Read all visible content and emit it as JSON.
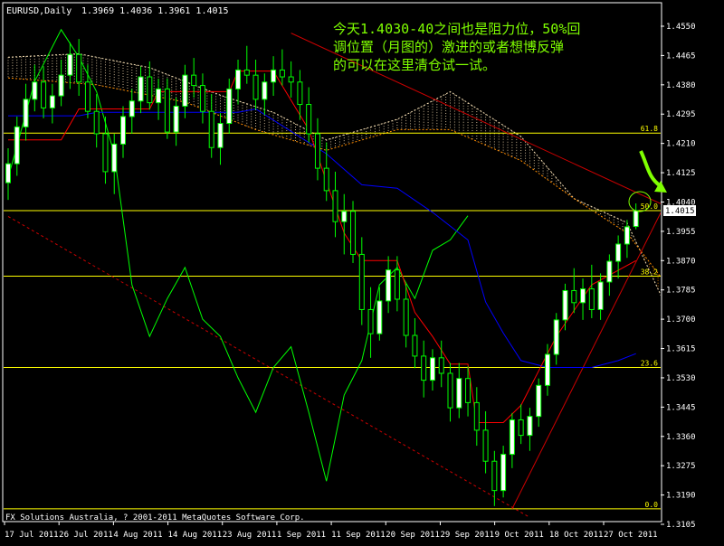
{
  "header": {
    "symbol": "EURUSD,Daily",
    "ohlc": "1.3969 1.4036 1.3961 1.4015"
  },
  "annotation": {
    "lines": [
      "今天1.4030-40之间也是阻力位，50%回",
      "调位置（月图的）激进的或者想博反弹",
      "的可以在这里清仓试一试。"
    ]
  },
  "footer": "FX Solutions Australia, ? 2001-2011 MetaQuotes Software Corp.",
  "colors": {
    "background": "#000000",
    "axis": "#ffffff",
    "candle_up": "#ffffff",
    "candle_down": "#000000",
    "candle_wick": "#00ff00",
    "kijun": "#ff0000",
    "tenkan": "#0000ff",
    "chikou": "#00ff00",
    "senkou_a": "#f5deb3",
    "senkou_b": "#ff8c00",
    "fib": "#ffff00",
    "trend": "#cc0000",
    "annotation": "#7fff00",
    "price_box_bg": "#ffffff",
    "price_box_fg": "#000000"
  },
  "chart_data": {
    "type": "candlestick",
    "title": "EURUSD,Daily",
    "ylim": [
      1.3105,
      1.455
    ],
    "y_ticks": [
      "1.4550",
      "1.4465",
      "1.4380",
      "1.4295",
      "1.4210",
      "1.4125",
      "1.4040",
      "1.3955",
      "1.3870",
      "1.3785",
      "1.3700",
      "1.3615",
      "1.3530",
      "1.3445",
      "1.3360",
      "1.3275",
      "1.3190",
      "1.3105"
    ],
    "x_ticks": [
      "17 Jul 2011",
      "26 Jul 2011",
      "4 Aug 2011",
      "14 Aug 2011",
      "23 Aug 2011",
      "1 Sep 2011",
      "11 Sep 2011",
      "20 Sep 2011",
      "29 Sep 2011",
      "9 Oct 2011",
      "18 Oct 2011",
      "27 Oct 2011"
    ],
    "current_price": "1.4015",
    "current_price_value": 1.4015,
    "fib_levels": [
      {
        "label": "61.8",
        "value": 1.424
      },
      {
        "label": "50.0",
        "value": 1.4015
      },
      {
        "label": "38.2",
        "value": 1.3825
      },
      {
        "label": "23.6",
        "value": 1.356
      },
      {
        "label": "0.0",
        "value": 1.315
      }
    ],
    "candles": [
      [
        1.4096,
        1.4196,
        1.4046,
        1.4151
      ],
      [
        1.4151,
        1.4288,
        1.4116,
        1.4258
      ],
      [
        1.4258,
        1.4383,
        1.4218,
        1.4338
      ],
      [
        1.4338,
        1.4438,
        1.4303,
        1.4388
      ],
      [
        1.4388,
        1.4433,
        1.4283,
        1.4313
      ],
      [
        1.4313,
        1.4383,
        1.4268,
        1.4348
      ],
      [
        1.4348,
        1.4453,
        1.4318,
        1.4408
      ],
      [
        1.4408,
        1.4503,
        1.4368,
        1.4468
      ],
      [
        1.4468,
        1.4513,
        1.4348,
        1.4388
      ],
      [
        1.4388,
        1.4438,
        1.4283,
        1.4303
      ],
      [
        1.4303,
        1.4353,
        1.4198,
        1.4238
      ],
      [
        1.4238,
        1.4288,
        1.4093,
        1.4128
      ],
      [
        1.4128,
        1.4238,
        1.4063,
        1.4208
      ],
      [
        1.4208,
        1.4318,
        1.4168,
        1.4288
      ],
      [
        1.4288,
        1.4368,
        1.4238,
        1.4333
      ],
      [
        1.4333,
        1.4433,
        1.4298,
        1.4403
      ],
      [
        1.4403,
        1.4448,
        1.4308,
        1.4328
      ],
      [
        1.4328,
        1.4398,
        1.4278,
        1.4368
      ],
      [
        1.4368,
        1.4398,
        1.4223,
        1.4243
      ],
      [
        1.4243,
        1.4343,
        1.4203,
        1.4318
      ],
      [
        1.4318,
        1.4438,
        1.4283,
        1.4408
      ],
      [
        1.4408,
        1.4458,
        1.4343,
        1.4378
      ],
      [
        1.4378,
        1.4413,
        1.4268,
        1.4303
      ],
      [
        1.4303,
        1.4353,
        1.4168,
        1.4198
      ],
      [
        1.4198,
        1.4298,
        1.4148,
        1.4268
      ],
      [
        1.4268,
        1.4398,
        1.4238,
        1.4368
      ],
      [
        1.4368,
        1.4453,
        1.4323,
        1.4423
      ],
      [
        1.4423,
        1.4493,
        1.4383,
        1.4408
      ],
      [
        1.4408,
        1.4453,
        1.4308,
        1.4338
      ],
      [
        1.4338,
        1.4413,
        1.4293,
        1.4388
      ],
      [
        1.4388,
        1.4463,
        1.4348,
        1.4423
      ],
      [
        1.4423,
        1.4483,
        1.4378,
        1.4403
      ],
      [
        1.4403,
        1.4448,
        1.4343,
        1.4388
      ],
      [
        1.4388,
        1.4423,
        1.4278,
        1.4323
      ],
      [
        1.4323,
        1.4373,
        1.4213,
        1.4238
      ],
      [
        1.4238,
        1.4283,
        1.4103,
        1.4138
      ],
      [
        1.4138,
        1.4213,
        1.4043,
        1.4073
      ],
      [
        1.4073,
        1.4128,
        1.3938,
        1.3983
      ],
      [
        1.3983,
        1.4063,
        1.3888,
        1.4013
      ],
      [
        1.4013,
        1.4043,
        1.3863,
        1.3888
      ],
      [
        1.3888,
        1.3938,
        1.3683,
        1.3728
      ],
      [
        1.3728,
        1.3793,
        1.3588,
        1.3658
      ],
      [
        1.3658,
        1.3793,
        1.3638,
        1.3753
      ],
      [
        1.3753,
        1.3883,
        1.3718,
        1.3843
      ],
      [
        1.3843,
        1.3883,
        1.3723,
        1.3758
      ],
      [
        1.3758,
        1.3803,
        1.3618,
        1.3653
      ],
      [
        1.3653,
        1.3703,
        1.3558,
        1.3593
      ],
      [
        1.3593,
        1.3638,
        1.3473,
        1.3523
      ],
      [
        1.3523,
        1.3613,
        1.3493,
        1.3588
      ],
      [
        1.3588,
        1.3638,
        1.3503,
        1.3543
      ],
      [
        1.3543,
        1.3573,
        1.3403,
        1.3443
      ],
      [
        1.3443,
        1.3573,
        1.3413,
        1.3528
      ],
      [
        1.3528,
        1.3563,
        1.3418,
        1.3458
      ],
      [
        1.3458,
        1.3503,
        1.3333,
        1.3378
      ],
      [
        1.3378,
        1.3433,
        1.3253,
        1.3288
      ],
      [
        1.3288,
        1.3318,
        1.3158,
        1.3203
      ],
      [
        1.3203,
        1.3333,
        1.3183,
        1.3308
      ],
      [
        1.3308,
        1.3428,
        1.3268,
        1.3408
      ],
      [
        1.3408,
        1.3453,
        1.3338,
        1.3363
      ],
      [
        1.3363,
        1.3443,
        1.3318,
        1.3418
      ],
      [
        1.3418,
        1.3528,
        1.3388,
        1.3508
      ],
      [
        1.3508,
        1.3628,
        1.3478,
        1.3598
      ],
      [
        1.3598,
        1.3718,
        1.3568,
        1.3698
      ],
      [
        1.3698,
        1.3803,
        1.3668,
        1.3783
      ],
      [
        1.3783,
        1.3848,
        1.3718,
        1.3748
      ],
      [
        1.3748,
        1.3818,
        1.3698,
        1.3788
      ],
      [
        1.3788,
        1.3858,
        1.3703,
        1.3728
      ],
      [
        1.3728,
        1.3833,
        1.3698,
        1.3808
      ],
      [
        1.3808,
        1.3888,
        1.3768,
        1.3868
      ],
      [
        1.3868,
        1.3943,
        1.3818,
        1.3918
      ],
      [
        1.3918,
        1.3988,
        1.3878,
        1.3968
      ],
      [
        1.3969,
        1.4036,
        1.3961,
        1.4015
      ]
    ],
    "kijun": [
      [
        0,
        1.422
      ],
      [
        6,
        1.422
      ],
      [
        8,
        1.431
      ],
      [
        16,
        1.431
      ],
      [
        17,
        1.436
      ],
      [
        25,
        1.436
      ],
      [
        26,
        1.442
      ],
      [
        30,
        1.442
      ],
      [
        34,
        1.425
      ],
      [
        36,
        1.41
      ],
      [
        38,
        1.395
      ],
      [
        40,
        1.387
      ],
      [
        44,
        1.387
      ],
      [
        46,
        1.372
      ],
      [
        48,
        1.365
      ],
      [
        50,
        1.357
      ],
      [
        52,
        1.357
      ],
      [
        53,
        1.34
      ],
      [
        56,
        1.34
      ],
      [
        58,
        1.345
      ],
      [
        60,
        1.355
      ],
      [
        62,
        1.365
      ],
      [
        66,
        1.38
      ],
      [
        71,
        1.387
      ]
    ],
    "tenkan": [
      [
        0,
        1.429
      ],
      [
        8,
        1.429
      ],
      [
        10,
        1.43
      ],
      [
        26,
        1.43
      ],
      [
        28,
        1.431
      ],
      [
        36,
        1.418
      ],
      [
        40,
        1.409
      ],
      [
        44,
        1.408
      ],
      [
        48,
        1.401
      ],
      [
        52,
        1.393
      ],
      [
        54,
        1.375
      ],
      [
        56,
        1.366
      ],
      [
        58,
        1.358
      ],
      [
        61,
        1.356
      ],
      [
        66,
        1.356
      ],
      [
        69,
        1.358
      ],
      [
        71,
        1.36
      ]
    ],
    "senkou_a": [
      [
        0,
        1.446
      ],
      [
        8,
        1.447
      ],
      [
        16,
        1.443
      ],
      [
        24,
        1.435
      ],
      [
        30,
        1.43
      ],
      [
        36,
        1.422
      ],
      [
        44,
        1.428
      ],
      [
        50,
        1.436
      ],
      [
        58,
        1.423
      ],
      [
        64,
        1.405
      ],
      [
        70,
        1.398
      ],
      [
        76,
        1.365
      ]
    ],
    "senkou_b": [
      [
        0,
        1.44
      ],
      [
        10,
        1.438
      ],
      [
        20,
        1.433
      ],
      [
        28,
        1.425
      ],
      [
        36,
        1.419
      ],
      [
        44,
        1.425
      ],
      [
        50,
        1.425
      ],
      [
        58,
        1.416
      ],
      [
        64,
        1.405
      ],
      [
        70,
        1.395
      ],
      [
        76,
        1.375
      ]
    ],
    "chikou": [
      [
        0,
        1.411
      ],
      [
        3,
        1.439
      ],
      [
        6,
        1.454
      ],
      [
        8,
        1.446
      ],
      [
        10,
        1.436
      ],
      [
        12,
        1.418
      ],
      [
        14,
        1.38
      ],
      [
        16,
        1.365
      ],
      [
        18,
        1.376
      ],
      [
        20,
        1.385
      ],
      [
        22,
        1.37
      ],
      [
        24,
        1.365
      ],
      [
        26,
        1.353
      ],
      [
        28,
        1.343
      ],
      [
        30,
        1.356
      ],
      [
        32,
        1.362
      ],
      [
        34,
        1.343
      ],
      [
        36,
        1.323
      ],
      [
        38,
        1.348
      ],
      [
        40,
        1.358
      ],
      [
        42,
        1.38
      ],
      [
        44,
        1.385
      ],
      [
        46,
        1.376
      ],
      [
        48,
        1.39
      ],
      [
        50,
        1.393
      ],
      [
        52,
        1.4
      ]
    ],
    "trend_lines": [
      {
        "name": "upper",
        "points": [
          [
            32,
            1.453
          ],
          [
            100,
            1.3725
          ]
        ]
      },
      {
        "name": "support",
        "points": [
          [
            57,
            1.315
          ],
          [
            75,
            1.407
          ]
        ]
      },
      {
        "name": "dashed",
        "points": [
          [
            0,
            1.3998
          ],
          [
            59,
            1.3125
          ]
        ]
      }
    ]
  }
}
